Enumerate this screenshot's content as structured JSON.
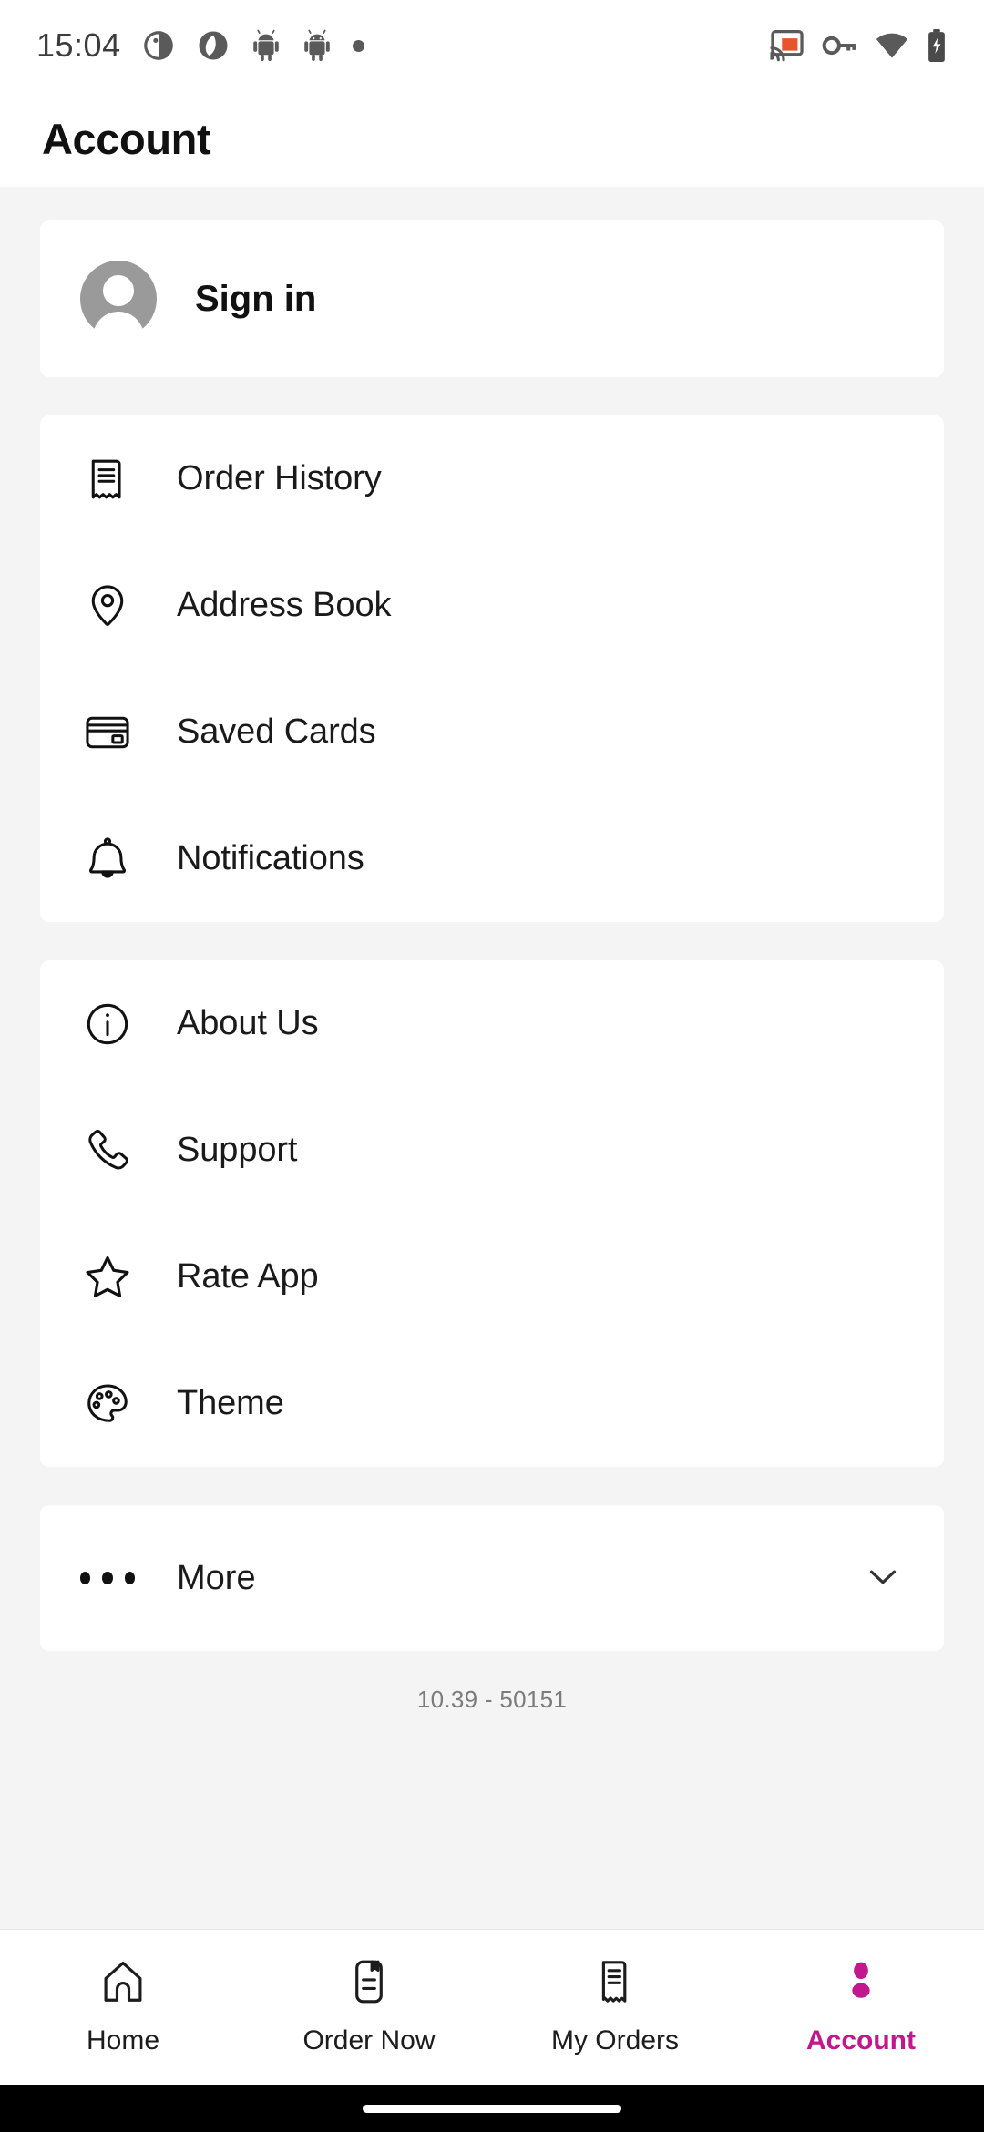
{
  "status_bar": {
    "time": "15:04",
    "notification_icons": [
      "moon-icon",
      "camera-lens-icon",
      "android-robot-icon",
      "android-robot-icon",
      "notification-dot-icon"
    ],
    "system_icons": [
      "cast-icon",
      "vpn-key-icon",
      "wifi-icon",
      "battery-charging-icon"
    ],
    "cast_accent_color": "#E8552D"
  },
  "header": {
    "title": "Account"
  },
  "account": {
    "sign_in_label": "Sign in",
    "avatar_icon": "person-avatar-icon"
  },
  "menu_groups": [
    {
      "items": [
        {
          "icon": "receipt-icon",
          "label": "Order History"
        },
        {
          "icon": "map-pin-icon",
          "label": "Address Book"
        },
        {
          "icon": "credit-card-icon",
          "label": "Saved Cards"
        },
        {
          "icon": "bell-icon",
          "label": "Notifications"
        }
      ]
    },
    {
      "items": [
        {
          "icon": "info-circle-icon",
          "label": "About Us"
        },
        {
          "icon": "phone-icon",
          "label": "Support"
        },
        {
          "icon": "star-icon",
          "label": "Rate App"
        },
        {
          "icon": "palette-icon",
          "label": "Theme"
        }
      ]
    }
  ],
  "more": {
    "label": "More",
    "leading_icon": "three-dots-icon",
    "trailing_icon": "chevron-down-icon"
  },
  "version": "10.39 - 50151",
  "bottom_nav": {
    "active_color": "#C2188D",
    "inactive_color": "#1c1c1c",
    "items": [
      {
        "icon": "home-icon",
        "label": "Home",
        "active": false
      },
      {
        "icon": "menu-card-icon",
        "label": "Order Now",
        "active": false
      },
      {
        "icon": "orders-receipt-icon",
        "label": "My Orders",
        "active": false
      },
      {
        "icon": "person-icon",
        "label": "Account",
        "active": true
      }
    ]
  }
}
